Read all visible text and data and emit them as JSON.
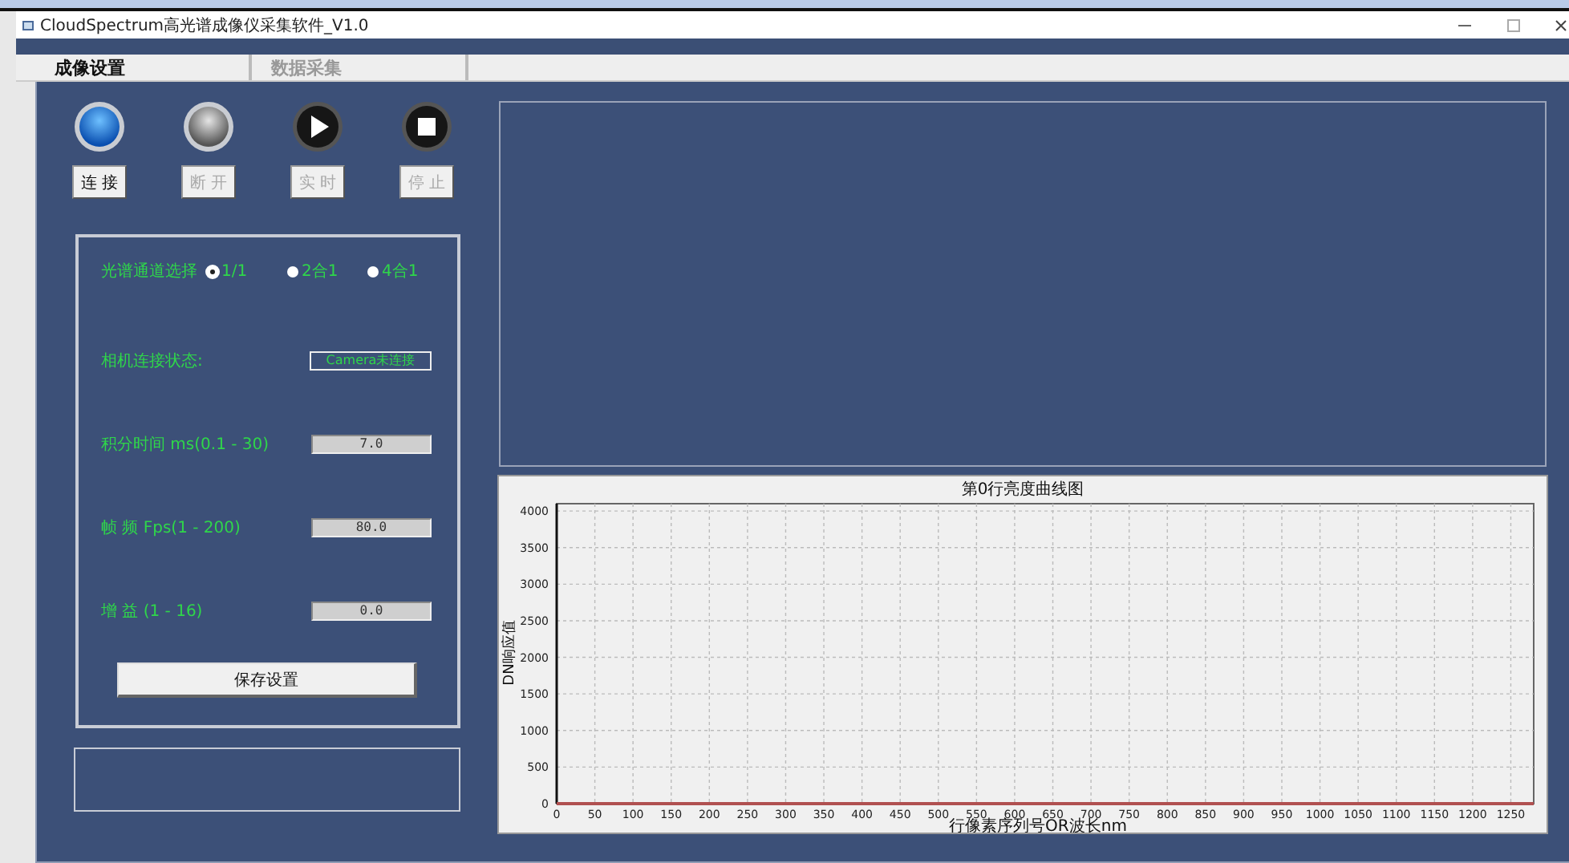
{
  "window": {
    "title": "CloudSpectrum高光谱成像仪采集软件_V1.0"
  },
  "tabs": [
    {
      "label": "成像设置",
      "selected": true
    },
    {
      "label": "数据采集",
      "selected": false
    }
  ],
  "controls": [
    {
      "kind": "connect",
      "label": "连 接",
      "disabled": false
    },
    {
      "kind": "disconnect",
      "label": "断 开",
      "disabled": true
    },
    {
      "kind": "play",
      "label": "实 时",
      "disabled": true
    },
    {
      "kind": "stop",
      "label": "停 止",
      "disabled": true
    }
  ],
  "settings": {
    "channel": {
      "label": "光谱通道选择",
      "options": [
        {
          "label": "1/1",
          "selected": true
        },
        {
          "label": "2合1",
          "selected": false
        },
        {
          "label": "4合1",
          "selected": false
        }
      ]
    },
    "fields": [
      {
        "kind": "status",
        "label": "相机连接状态:",
        "value": "Camera未连接"
      },
      {
        "kind": "input",
        "label": "积分时间 ms(0.1 - 30)",
        "value": "7.0"
      },
      {
        "kind": "input",
        "label": "帧 频 Fps(1 - 200)",
        "value": "80.0"
      },
      {
        "kind": "input",
        "label": "增 益 (1 - 16)",
        "value": "0.0"
      }
    ],
    "save_button": "保存设置"
  },
  "chart": {
    "chart_data": {
      "type": "line",
      "title": "第0行亮度曲线图",
      "xlabel": "行像素序列号OR波长nm",
      "ylabel": "DN响应值",
      "xlim": [
        0,
        1280
      ],
      "ylim": [
        0,
        4100
      ],
      "xticks": [
        0,
        50,
        100,
        150,
        200,
        250,
        300,
        350,
        400,
        450,
        500,
        550,
        600,
        650,
        700,
        750,
        800,
        850,
        900,
        950,
        1000,
        1050,
        1100,
        1150,
        1200,
        1250
      ],
      "yticks": [
        0,
        500,
        1000,
        1500,
        2000,
        2500,
        3000,
        3500,
        4000
      ],
      "x": [
        0,
        1280
      ],
      "grid": true,
      "series": [
        {
          "color": "#b05050",
          "values": [
            0,
            0
          ]
        }
      ]
    }
  }
}
